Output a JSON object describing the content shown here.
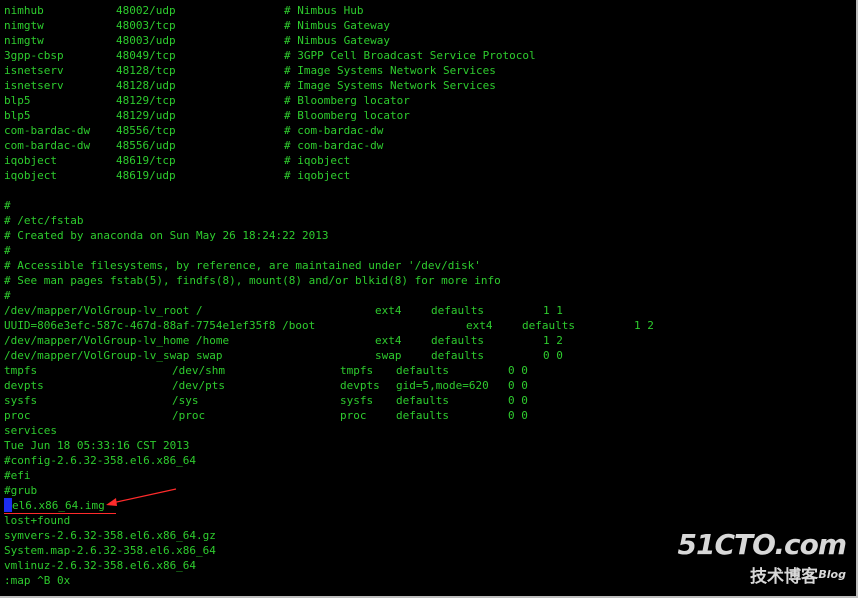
{
  "services_lines": [
    [
      "nimhub",
      "48002/udp",
      "# Nimbus Hub"
    ],
    [
      "nimgtw",
      "48003/tcp",
      "# Nimbus Gateway"
    ],
    [
      "nimgtw",
      "48003/udp",
      "# Nimbus Gateway"
    ],
    [
      "3gpp-cbsp",
      "48049/tcp",
      "# 3GPP Cell Broadcast Service Protocol"
    ],
    [
      "isnetserv",
      "48128/tcp",
      "# Image Systems Network Services"
    ],
    [
      "isnetserv",
      "48128/udp",
      "# Image Systems Network Services"
    ],
    [
      "blp5",
      "48129/tcp",
      "# Bloomberg locator"
    ],
    [
      "blp5",
      "48129/udp",
      "# Bloomberg locator"
    ],
    [
      "com-bardac-dw",
      "48556/tcp",
      "# com-bardac-dw"
    ],
    [
      "com-bardac-dw",
      "48556/udp",
      "# com-bardac-dw"
    ],
    [
      "iqobject",
      "48619/tcp",
      "# iqobject"
    ],
    [
      "iqobject",
      "48619/udp",
      "# iqobject"
    ]
  ],
  "fstab_comments": [
    "#",
    "# /etc/fstab",
    "# Created by anaconda on Sun May 26 18:24:22 2013",
    "#",
    "# Accessible filesystems, by reference, are maintained under '/dev/disk'",
    "# See man pages fstab(5), findfs(8), mount(8) and/or blkid(8) for more info",
    "#"
  ],
  "fstab_entries": [
    [
      "/dev/mapper/VolGroup-lv_root /",
      "ext4",
      "defaults",
      "1 1"
    ],
    [
      "UUID=806e3efc-587c-467d-88af-7754e1ef35f8 /boot",
      "ext4",
      "defaults",
      "1 2"
    ],
    [
      "/dev/mapper/VolGroup-lv_home /home",
      "ext4",
      "defaults",
      "1 2"
    ],
    [
      "/dev/mapper/VolGroup-lv_swap swap",
      "swap",
      "defaults",
      "0 0"
    ]
  ],
  "pseudo_fs": [
    [
      "tmpfs",
      "/dev/shm",
      "tmpfs",
      "defaults",
      "0 0"
    ],
    [
      "devpts",
      "/dev/pts",
      "devpts",
      "gid=5,mode=620",
      "0 0"
    ],
    [
      "sysfs",
      "/sys",
      "sysfs",
      "defaults",
      "0 0"
    ],
    [
      "proc",
      "/proc",
      "proc",
      "defaults",
      "0 0"
    ]
  ],
  "misc_lines": [
    "services",
    "Tue Jun 18 05:33:16 CST 2013",
    "#config-2.6.32-358.el6.x86_64",
    "#efi",
    "#grub"
  ],
  "cursor_line": "el6.x86_64.img",
  "tail_lines": [
    "lost+found",
    "symvers-2.6.32-358.el6.x86_64.gz",
    "System.map-2.6.32-358.el6.x86_64",
    "vmlinuz-2.6.32-358.el6.x86_64"
  ],
  "command_line": ":map ^B 0x",
  "watermark": {
    "site": "51CTO.com",
    "cn": "技术博客",
    "blog": "Blog"
  },
  "colors": {
    "background": "#000000",
    "text": "#2ecc2e",
    "cursor": "#1d2cf0",
    "annotation": "#ff2b2b"
  }
}
